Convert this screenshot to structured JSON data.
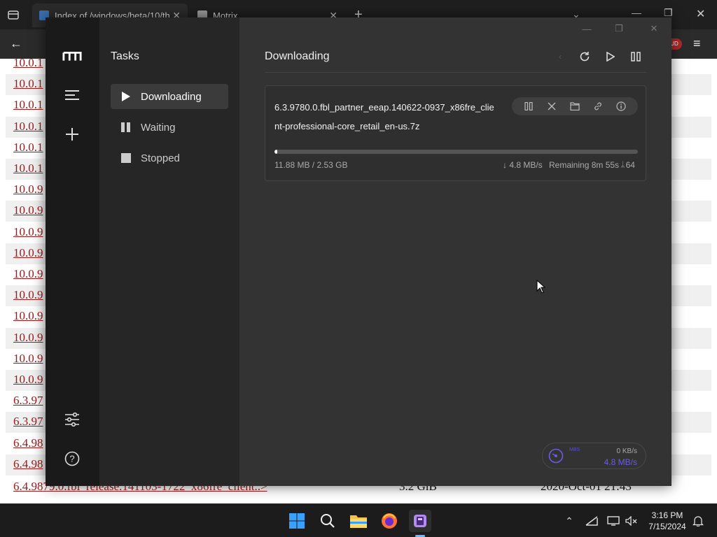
{
  "browser": {
    "tabs": [
      {
        "title": "Index of /windows/beta/10/th",
        "active": true
      },
      {
        "title": "Motrix",
        "active": false
      }
    ],
    "new_tab": "+",
    "badge": "UD",
    "listing_rows": [
      "10.0.1",
      "10.0.1",
      "10.0.1",
      "10.0.1",
      "10.0.1",
      "10.0.1",
      "10.0.9",
      "10.0.9",
      "10.0.9",
      "10.0.9",
      "10.0.9",
      "10.0.9",
      "10.0.9",
      "10.0.9",
      "10.0.9",
      "10.0.9",
      "6.3.97",
      "6.3.97",
      "6.4.98",
      "6.4.98"
    ],
    "last_row": {
      "name": "6.4.9879.0.fbl_release.141103-1722_x86fre_client..>",
      "size": "3.2 GiB",
      "date": "2020-Oct-01 21:43"
    }
  },
  "motrix": {
    "sidebar": {
      "title": "Tasks",
      "items": [
        {
          "label": "Downloading",
          "icon": "play-icon",
          "active": true
        },
        {
          "label": "Waiting",
          "icon": "pause-icon",
          "active": false
        },
        {
          "label": "Stopped",
          "icon": "stop-icon",
          "active": false
        }
      ]
    },
    "main": {
      "title": "Downloading"
    },
    "task": {
      "filename": "6.3.9780.0.fbl_partner_eeap.140622-0937_x86fre_client-professional-core_retail_en-us.7z",
      "progress_fraction": 0.005,
      "size_text": "11.88 MB / 2.53 GB",
      "speed_text": "↓ 4.8 MB/s",
      "remaining_text": "Remaining 8m 55s",
      "connections_text": "64"
    },
    "speedometer": {
      "label": "MBS",
      "upload": "0 KB/s",
      "download": "4.8 MB/s"
    }
  },
  "taskbar": {
    "time": "3:16 PM",
    "date": "7/15/2024"
  },
  "colors": {
    "accent": "#6a5ce0",
    "link": "#9b1b1b"
  }
}
